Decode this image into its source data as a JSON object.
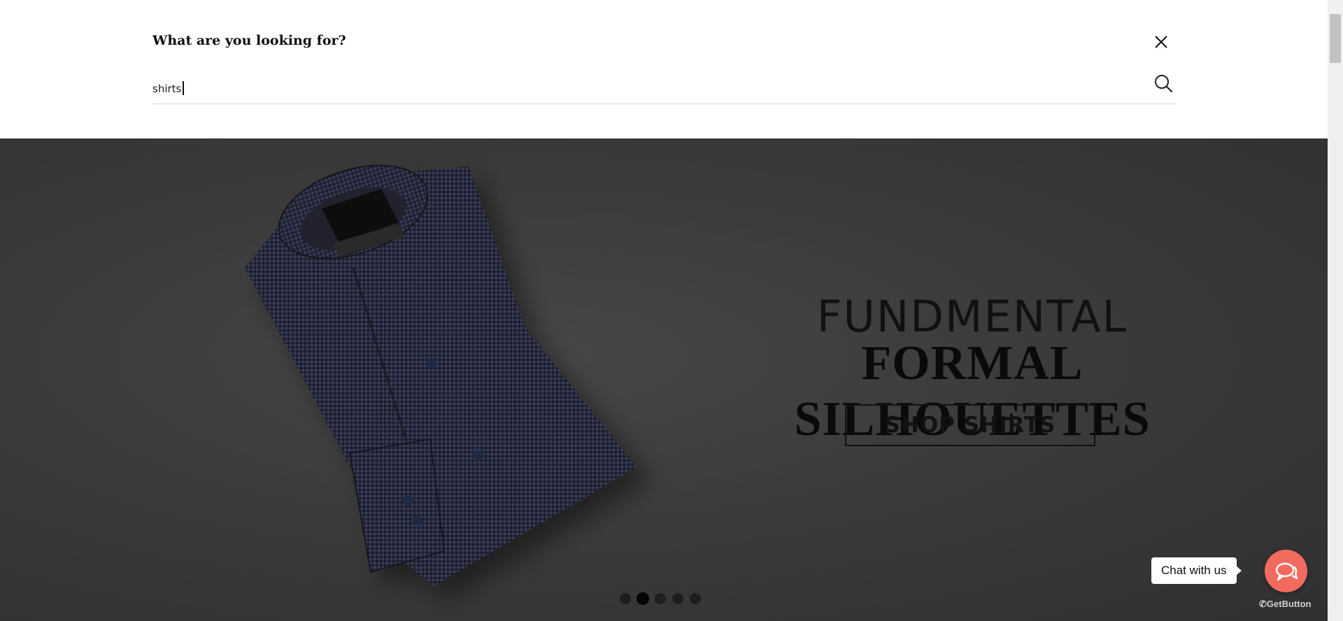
{
  "search": {
    "title": "What are you looking for?",
    "query": "shirts",
    "placeholder": "",
    "close_icon": "close-icon",
    "submit_icon": "search-icon"
  },
  "hero": {
    "line1": "FUNDMENTAL",
    "line2": "FORMAL SILHOUETTES",
    "cta_label": "SHOP SHIRTS",
    "slides": 5,
    "active_slide": 2
  },
  "chat": {
    "label": "Chat with us",
    "branding": "GetButton",
    "icon": "chat-bubble-icon",
    "color": "#f36b5f"
  },
  "colors": {
    "hero_bg": "#3a3a3a",
    "text_dark": "#111111"
  }
}
